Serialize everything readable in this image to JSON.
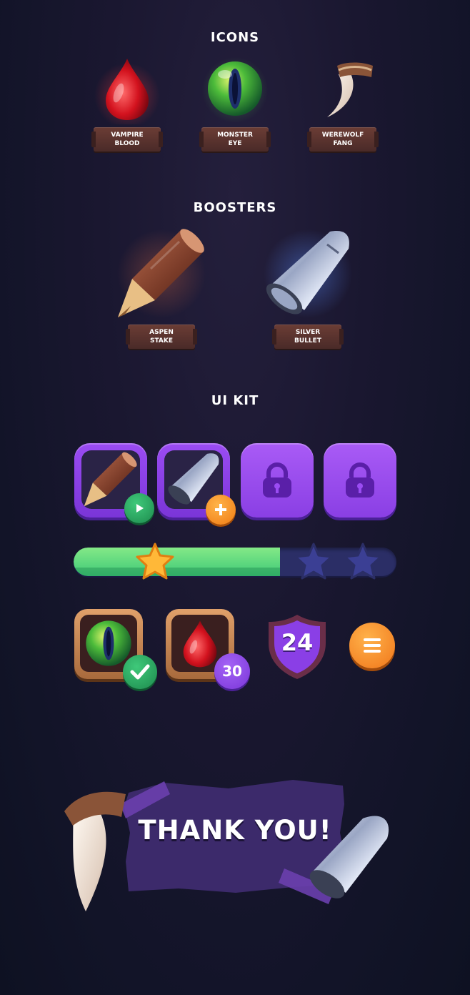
{
  "sections": {
    "icons_title": "ICONS",
    "boosters_title": "BOOSTERS",
    "uikit_title": "UI KIT"
  },
  "icons": [
    {
      "label": "VAMPIRE\nBLOOD",
      "icon": "blood-drop-icon"
    },
    {
      "label": "MONSTER\nEYE",
      "icon": "monster-eye-icon"
    },
    {
      "label": "WEREWOLF\nFANG",
      "icon": "werewolf-fang-icon"
    }
  ],
  "boosters": [
    {
      "label": "ASPEN\nSTAKE",
      "icon": "aspen-stake-icon"
    },
    {
      "label": "SILVER\nBULLET",
      "icon": "silver-bullet-icon"
    }
  ],
  "uikit": {
    "slots": [
      {
        "icon": "aspen-stake-icon",
        "badge": "play-icon"
      },
      {
        "icon": "silver-bullet-icon",
        "badge": "plus-icon"
      },
      {
        "icon": "lock-icon",
        "locked": true
      },
      {
        "icon": "lock-icon",
        "locked": true
      }
    ],
    "progress": {
      "fraction": 0.64,
      "stars_earned": 1,
      "stars_total": 3
    },
    "inventory": [
      {
        "icon": "monster-eye-icon",
        "badge": "check-icon"
      },
      {
        "icon": "blood-drop-icon",
        "badge_count": "30"
      }
    ],
    "level_shield": "24",
    "menu_button": "menu-icon"
  },
  "thanks": "THANK YOU!",
  "colors": {
    "background": "#1a1730",
    "slot_purple": "#8b3fe8",
    "progress_green": "#4fd27c",
    "progress_track": "#2b2e66",
    "plank_brown": "#5a3330",
    "frame_tan": "#c98a52",
    "badge_green": "#28a35e",
    "badge_orange": "#f58a1f",
    "shield_purple": "#7d3fe0"
  }
}
